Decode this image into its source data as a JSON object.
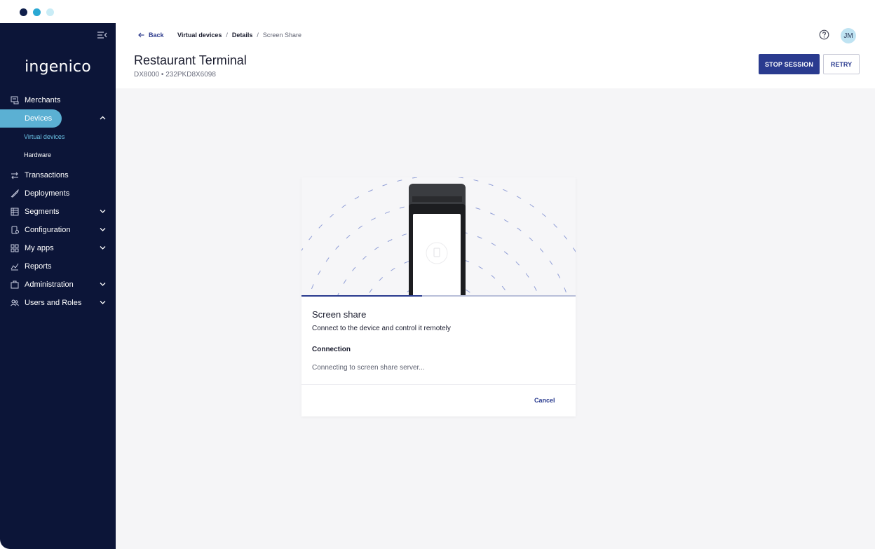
{
  "chrome": {
    "dots": [
      "#0f1f4b",
      "#2aa8d3",
      "#c9ecf6"
    ]
  },
  "sidebar": {
    "logo": "ingenico",
    "items": [
      {
        "label": "Merchants",
        "icon": "merchants-icon"
      },
      {
        "label": "Devices",
        "icon": "devices-icon",
        "expanded": true,
        "active": true
      },
      {
        "label": "Virtual devices",
        "sub": true,
        "current": true
      },
      {
        "label": "Hardware",
        "sub": true
      },
      {
        "label": "Transactions",
        "icon": "transactions-icon"
      },
      {
        "label": "Deployments",
        "icon": "rocket-icon"
      },
      {
        "label": "Segments",
        "icon": "segments-icon",
        "expandable": true
      },
      {
        "label": "Configuration",
        "icon": "configuration-icon",
        "expandable": true
      },
      {
        "label": "My apps",
        "icon": "apps-icon",
        "expandable": true
      },
      {
        "label": "Reports",
        "icon": "reports-icon"
      },
      {
        "label": "Administration",
        "icon": "briefcase-icon",
        "expandable": true
      },
      {
        "label": "Users and Roles",
        "icon": "users-icon",
        "expandable": true
      }
    ]
  },
  "header": {
    "back_label": "Back",
    "breadcrumbs": [
      "Virtual devices",
      "Details",
      "Screen Share"
    ],
    "title": "Restaurant Terminal",
    "subtitle": "DX8000 • 232PKD8X6098",
    "avatar_initials": "JM",
    "stop_label": "STOP SESSION",
    "retry_label": "RETRY"
  },
  "dialog": {
    "title": "Screen share",
    "description": "Connect to the device and control it remotely",
    "connection_label": "Connection",
    "connection_status": "Connecting to screen share server...",
    "progress_percent": 44,
    "cancel_label": "Cancel"
  },
  "colors": {
    "sidebar_bg": "#0c1538",
    "accent": "#2a3b8f",
    "active_pill": "#5bb0d3",
    "sub_current": "#6bc4e6"
  }
}
